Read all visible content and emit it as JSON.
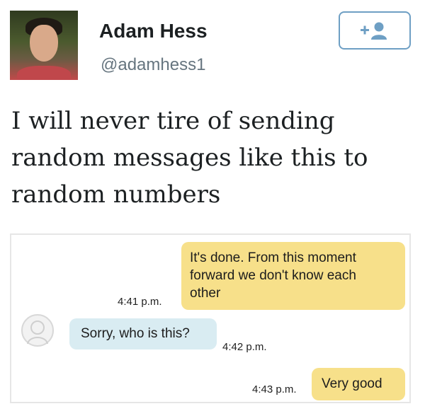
{
  "profile": {
    "name": "Adam Hess",
    "handle": "@adamhess1"
  },
  "follow_button": {
    "icon": "add-user-icon"
  },
  "tweet": {
    "lines": [
      "I will never tire of sending",
      "random messages like this to",
      "random numbers"
    ]
  },
  "chat": {
    "messages": [
      {
        "direction": "sent",
        "lines": [
          "It's done. From this moment",
          "forward we don't know each",
          "other"
        ],
        "time": "4:41 p.m."
      },
      {
        "direction": "received",
        "lines": [
          "Sorry, who is this?"
        ],
        "time": "4:42 p.m."
      },
      {
        "direction": "sent",
        "lines": [
          "Very good"
        ],
        "time": "4:43 p.m."
      }
    ]
  },
  "colors": {
    "sent_bubble": "#f7e08a",
    "received_bubble": "#d9ecf2",
    "follow_border": "#6e9fc4"
  }
}
